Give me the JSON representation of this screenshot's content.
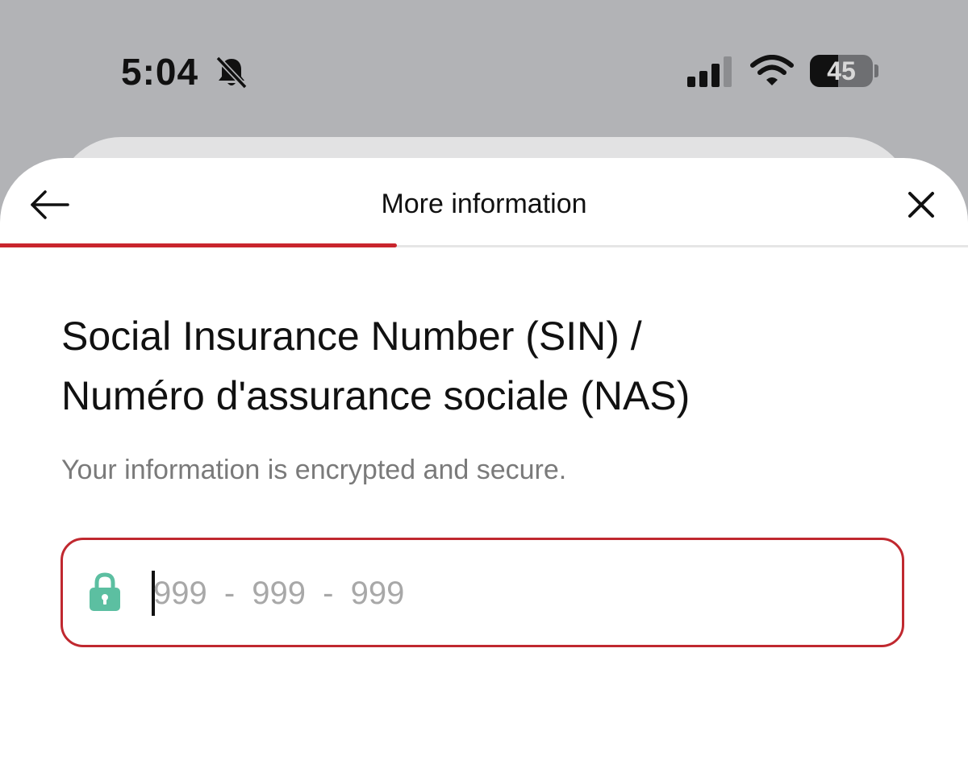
{
  "status_bar": {
    "time": "5:04",
    "battery_level": "45",
    "icons": [
      "bell-slash-icon",
      "cellular-signal-icon",
      "wifi-icon",
      "battery-icon"
    ]
  },
  "header": {
    "title": "More information",
    "back_icon": "arrow-left-icon",
    "close_icon": "close-icon"
  },
  "progress": {
    "fraction": 0.41,
    "color": "#c9252d"
  },
  "main": {
    "title_line1": "Social Insurance Number (SIN) /",
    "title_line2": "Numéro d'assurance sociale (NAS)",
    "subtitle": "Your information is encrypted and secure.",
    "sin_field": {
      "value": "",
      "placeholder": "999 - 999 - 999",
      "icon": "lock-icon",
      "border_color": "#c0282f",
      "icon_color": "#5cbfa1"
    }
  }
}
